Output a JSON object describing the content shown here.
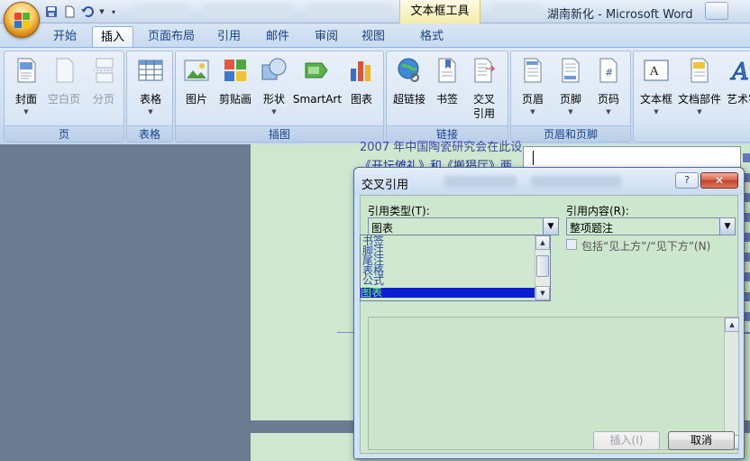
{
  "titlebar": {
    "context_tool": "文本框工具",
    "document_title": "湖南新化 - Microsoft Word"
  },
  "tabs": [
    {
      "label": "开始"
    },
    {
      "label": "插入"
    },
    {
      "label": "页面布局"
    },
    {
      "label": "引用"
    },
    {
      "label": "邮件"
    },
    {
      "label": "审阅"
    },
    {
      "label": "视图"
    },
    {
      "label": "格式"
    }
  ],
  "ribbon": {
    "groups": {
      "pages": {
        "label": "页",
        "buttons": [
          "封面",
          "空白页",
          "分页"
        ]
      },
      "tables": {
        "label": "表格",
        "buttons": [
          "表格"
        ]
      },
      "illustrations": {
        "label": "插图",
        "buttons": [
          "图片",
          "剪贴画",
          "形状",
          "SmartArt",
          "图表"
        ]
      },
      "links": {
        "label": "链接",
        "buttons": [
          "超链接",
          "书签",
          "交叉",
          "引用"
        ]
      },
      "header_footer": {
        "label": "页眉和页脚",
        "buttons": [
          "页眉",
          "页脚",
          "页码"
        ]
      },
      "text": {
        "buttons": [
          "文本框",
          "文档部件",
          "艺术字"
        ]
      }
    },
    "colors": {
      "ribbon_bg": "#dfe9f5",
      "label_text": "#15428b"
    }
  },
  "document": {
    "lines": [
      "2007 年中国陶瓷研究会在此设",
      "《开坛傩礼》和《搬猖厅》两"
    ],
    "page_color": "#cfe6cf",
    "text_color": "#1f2f9f"
  },
  "dialog": {
    "title": "交叉引用",
    "help_label": "?",
    "close_label": "✕",
    "reference_type_label": "引用类型(T):",
    "reference_type_value": "图表",
    "reference_type_options": [
      "书签",
      "脚注",
      "尾注",
      "表格",
      "公式",
      "图表"
    ],
    "reference_content_label": "引用内容(R):",
    "reference_content_value": "整项题注",
    "include_above_below_label": "包括“见上方”/“见下方”(N)",
    "include_above_below_checked": false,
    "insert_button": "插入(I)",
    "cancel_button": "取消",
    "selection_color": "#0a1fd1"
  }
}
